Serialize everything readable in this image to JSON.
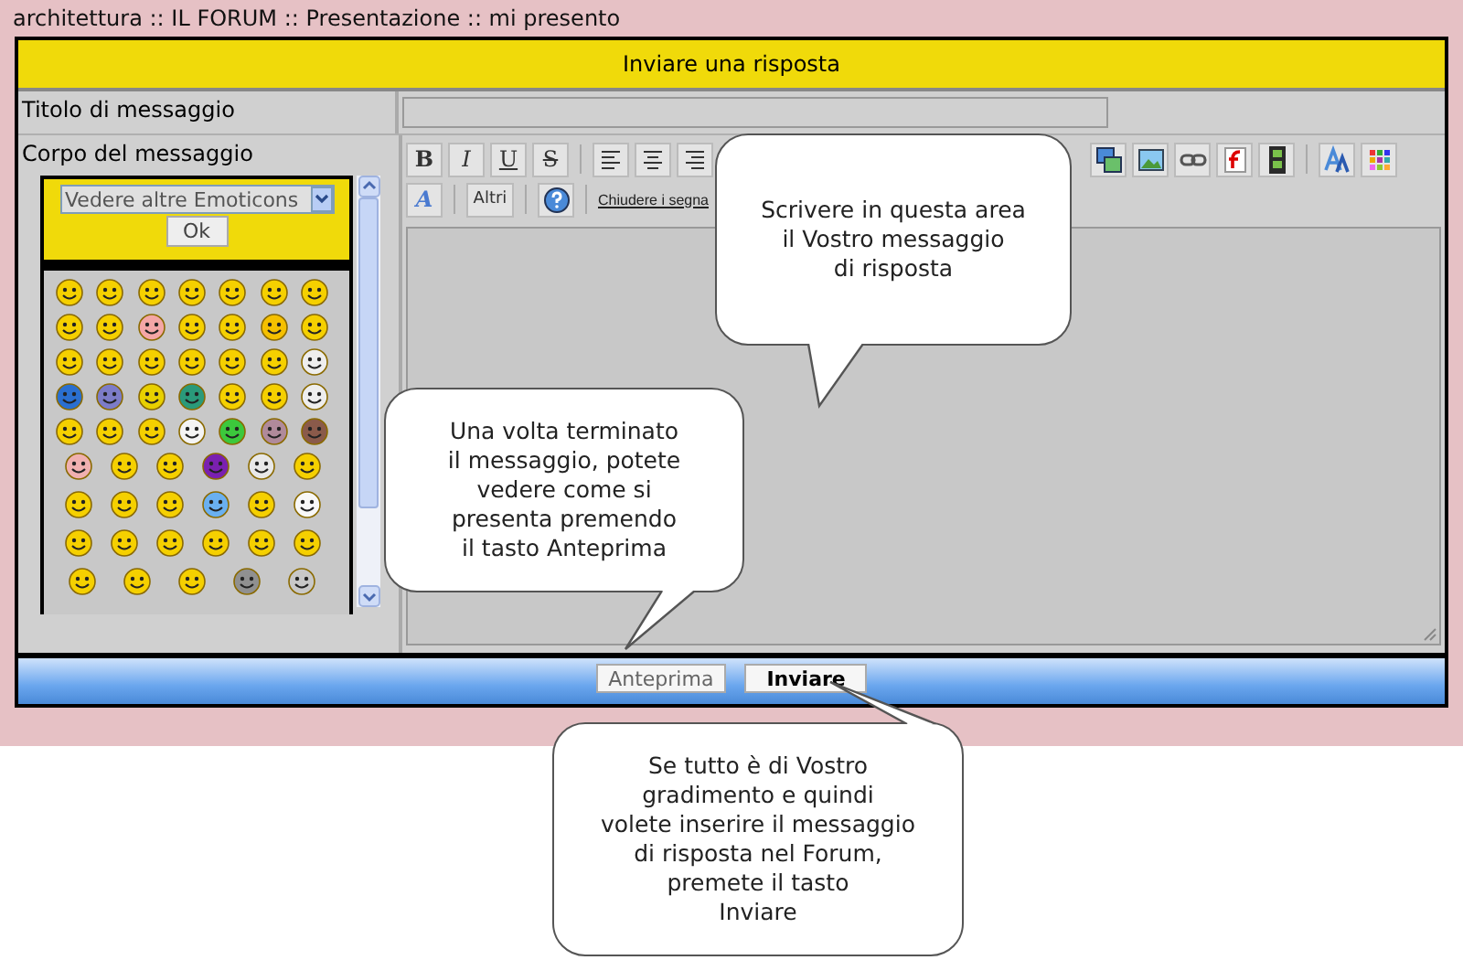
{
  "breadcrumb": "architettura  :: IL FORUM :: Presentazione :: mi presento",
  "form": {
    "header": "Inviare una risposta",
    "title_label": "Titolo di messaggio",
    "body_label": "Corpo del messaggio",
    "emoticon_select": "Vedere altre Emoticons",
    "ok_button": "Ok",
    "toolbar_row_1": [
      {
        "kind": "text",
        "label": "B"
      },
      {
        "kind": "text",
        "label": "I"
      },
      {
        "kind": "text",
        "label": "U"
      },
      {
        "kind": "text",
        "label": "S"
      },
      {
        "kind": "sep"
      },
      {
        "kind": "icon"
      },
      {
        "kind": "icon"
      },
      {
        "kind": "icon"
      },
      {
        "kind": "gap"
      },
      {
        "kind": "icon"
      },
      {
        "kind": "icon"
      },
      {
        "kind": "icon"
      },
      {
        "kind": "icon"
      },
      {
        "kind": "icon"
      },
      {
        "kind": "sep"
      },
      {
        "kind": "icon"
      },
      {
        "kind": "icon"
      }
    ],
    "toolbar_row_2": [
      {
        "kind": "text",
        "label": "A"
      },
      {
        "kind": "sep"
      },
      {
        "kind": "text",
        "label": "Altri"
      },
      {
        "kind": "sep"
      },
      {
        "kind": "icon"
      },
      {
        "kind": "sep"
      },
      {
        "kind": "link",
        "label": "Chiudere i segna"
      }
    ],
    "buttons": [
      "Anteprima",
      "Inviare"
    ]
  },
  "callouts": [
    {
      "kind": "editor",
      "text": "Scrivere in questa area\nil Vostro messaggio\ndi risposta"
    },
    {
      "kind": "preview",
      "text": "Una volta terminato\nil messaggio, potete\nvedere come si\npresenta premendo\nil tasto Anteprima"
    },
    {
      "kind": "send",
      "text": "Se tutto è di Vostro\ngradimento e quindi\nvolete inserire il messaggio\ndi risposta nel Forum,\npremete il tasto\nInviare"
    }
  ]
}
